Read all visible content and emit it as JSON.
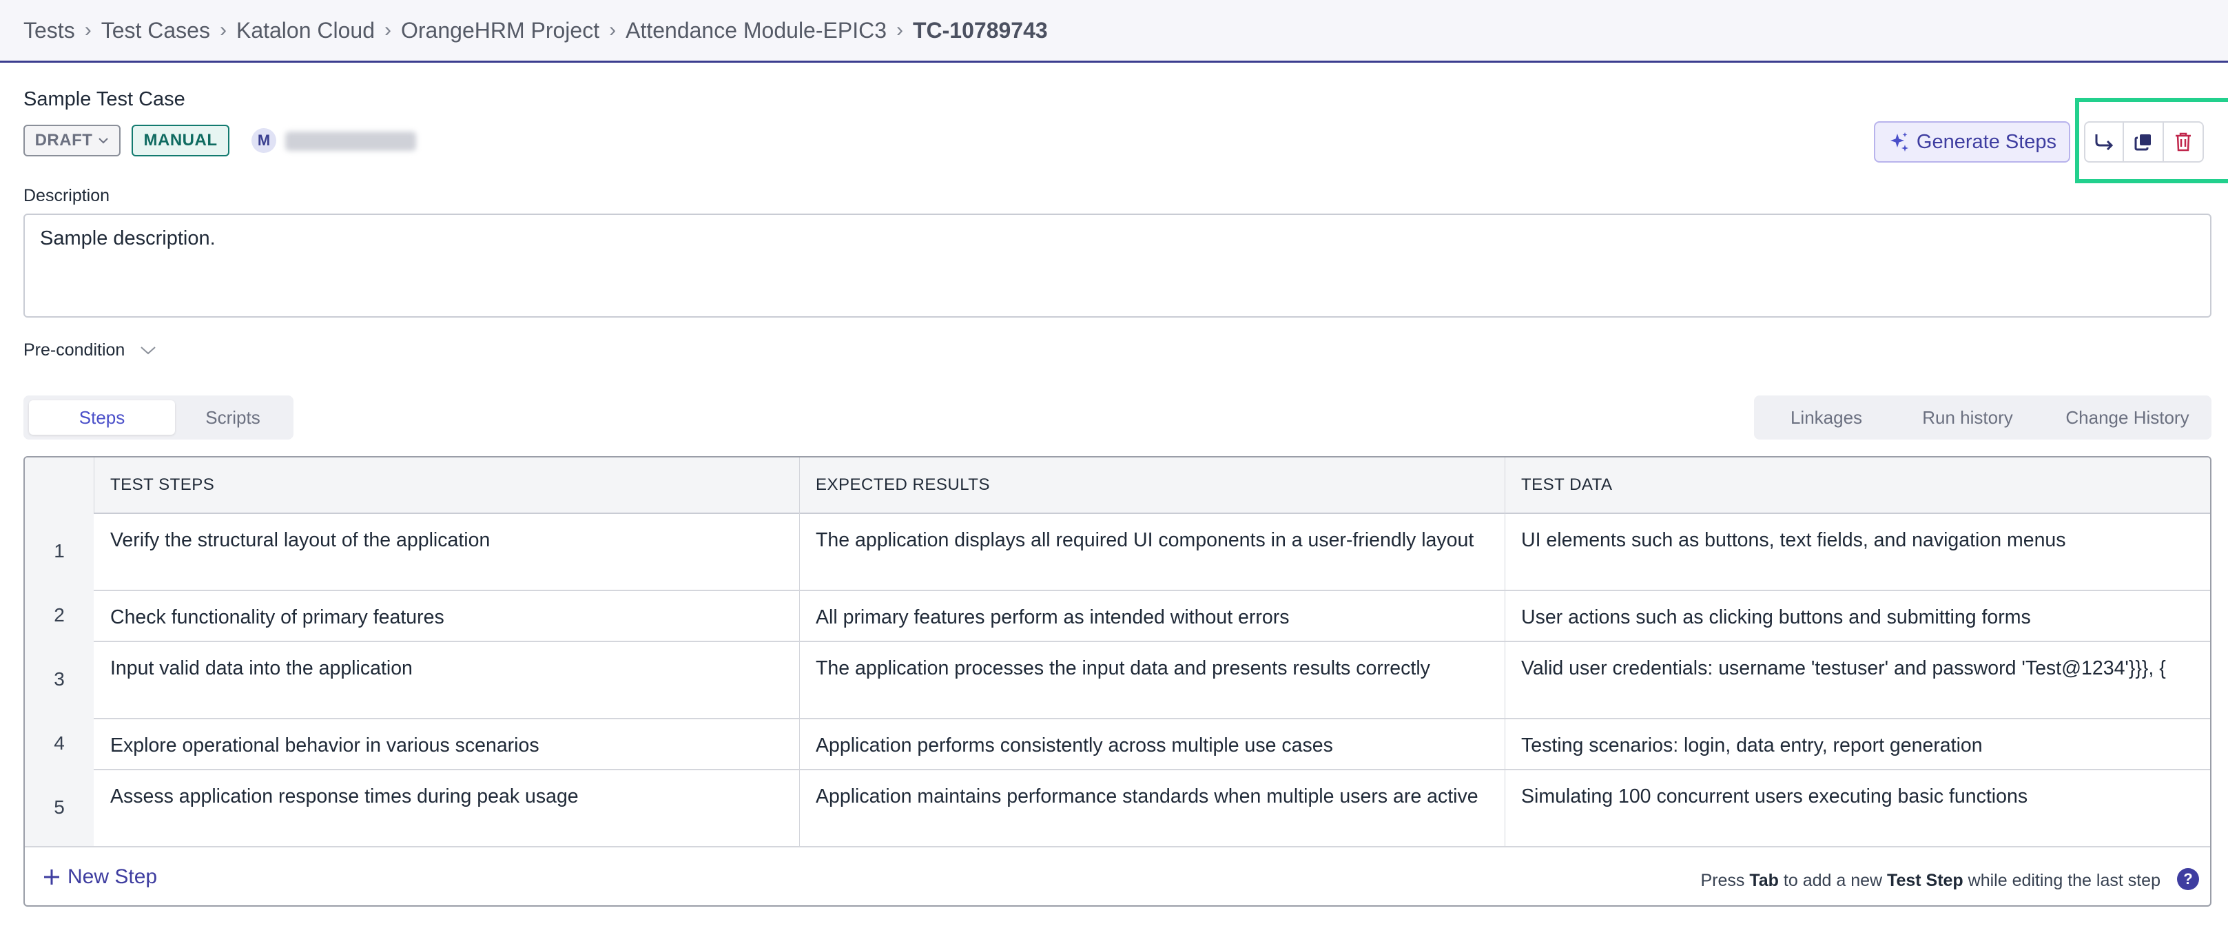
{
  "breadcrumb": {
    "items": [
      "Tests",
      "Test Cases",
      "Katalon Cloud",
      "OrangeHRM Project",
      "Attendance Module-EPIC3"
    ],
    "current": "TC-10789743",
    "separator": "›"
  },
  "test_case": {
    "title": "Sample Test Case",
    "status": "DRAFT",
    "type": "MANUAL",
    "assignee_initial": "M"
  },
  "actions": {
    "generate_steps_label": "Generate Steps",
    "icons": [
      "share-arrow-icon",
      "duplicate-icon",
      "delete-icon"
    ]
  },
  "description": {
    "label": "Description",
    "value": "Sample description."
  },
  "precondition": {
    "label": "Pre-condition"
  },
  "tabs_left": [
    "Steps",
    "Scripts"
  ],
  "tabs_left_active": "Steps",
  "tabs_right": [
    "Linkages",
    "Run history",
    "Change History"
  ],
  "table": {
    "headers": [
      "TEST STEPS",
      "EXPECTED RESULTS",
      "TEST DATA"
    ],
    "rows": [
      {
        "num": "1",
        "step": "Verify the structural layout of the application",
        "expected": "The application displays all required UI components in a user-friendly layout",
        "data": "UI elements such as buttons, text fields, and navigation menus"
      },
      {
        "num": "2",
        "step": "Check functionality of primary features",
        "expected": "All primary features perform as intended without errors",
        "data": "User actions such as clicking buttons and submitting forms"
      },
      {
        "num": "3",
        "step": "Input valid data into the application",
        "expected": "The application processes the input data and presents results correctly",
        "data": "Valid user credentials: username 'testuser' and password 'Test@1234'}}}, {"
      },
      {
        "num": "4",
        "step": "Explore operational behavior in various scenarios",
        "expected": "Application performs consistently across multiple use cases",
        "data": "Testing scenarios: login, data entry, report generation"
      },
      {
        "num": "5",
        "step": "Assess application response times during peak usage",
        "expected": "Application maintains performance standards when multiple users are active",
        "data": "Simulating 100 concurrent users executing basic functions"
      }
    ]
  },
  "footer": {
    "new_step_label": "New Step",
    "hint_prefix": "Press",
    "hint_key": "Tab",
    "hint_middle": "to add a new",
    "hint_target": "Test Step",
    "hint_suffix": "while editing the last step",
    "help_label": "?"
  },
  "colors": {
    "accent": "#3e3da0",
    "highlight": "#22d08d",
    "manual_tag": "#0f6b61",
    "delete": "#c0264b"
  }
}
